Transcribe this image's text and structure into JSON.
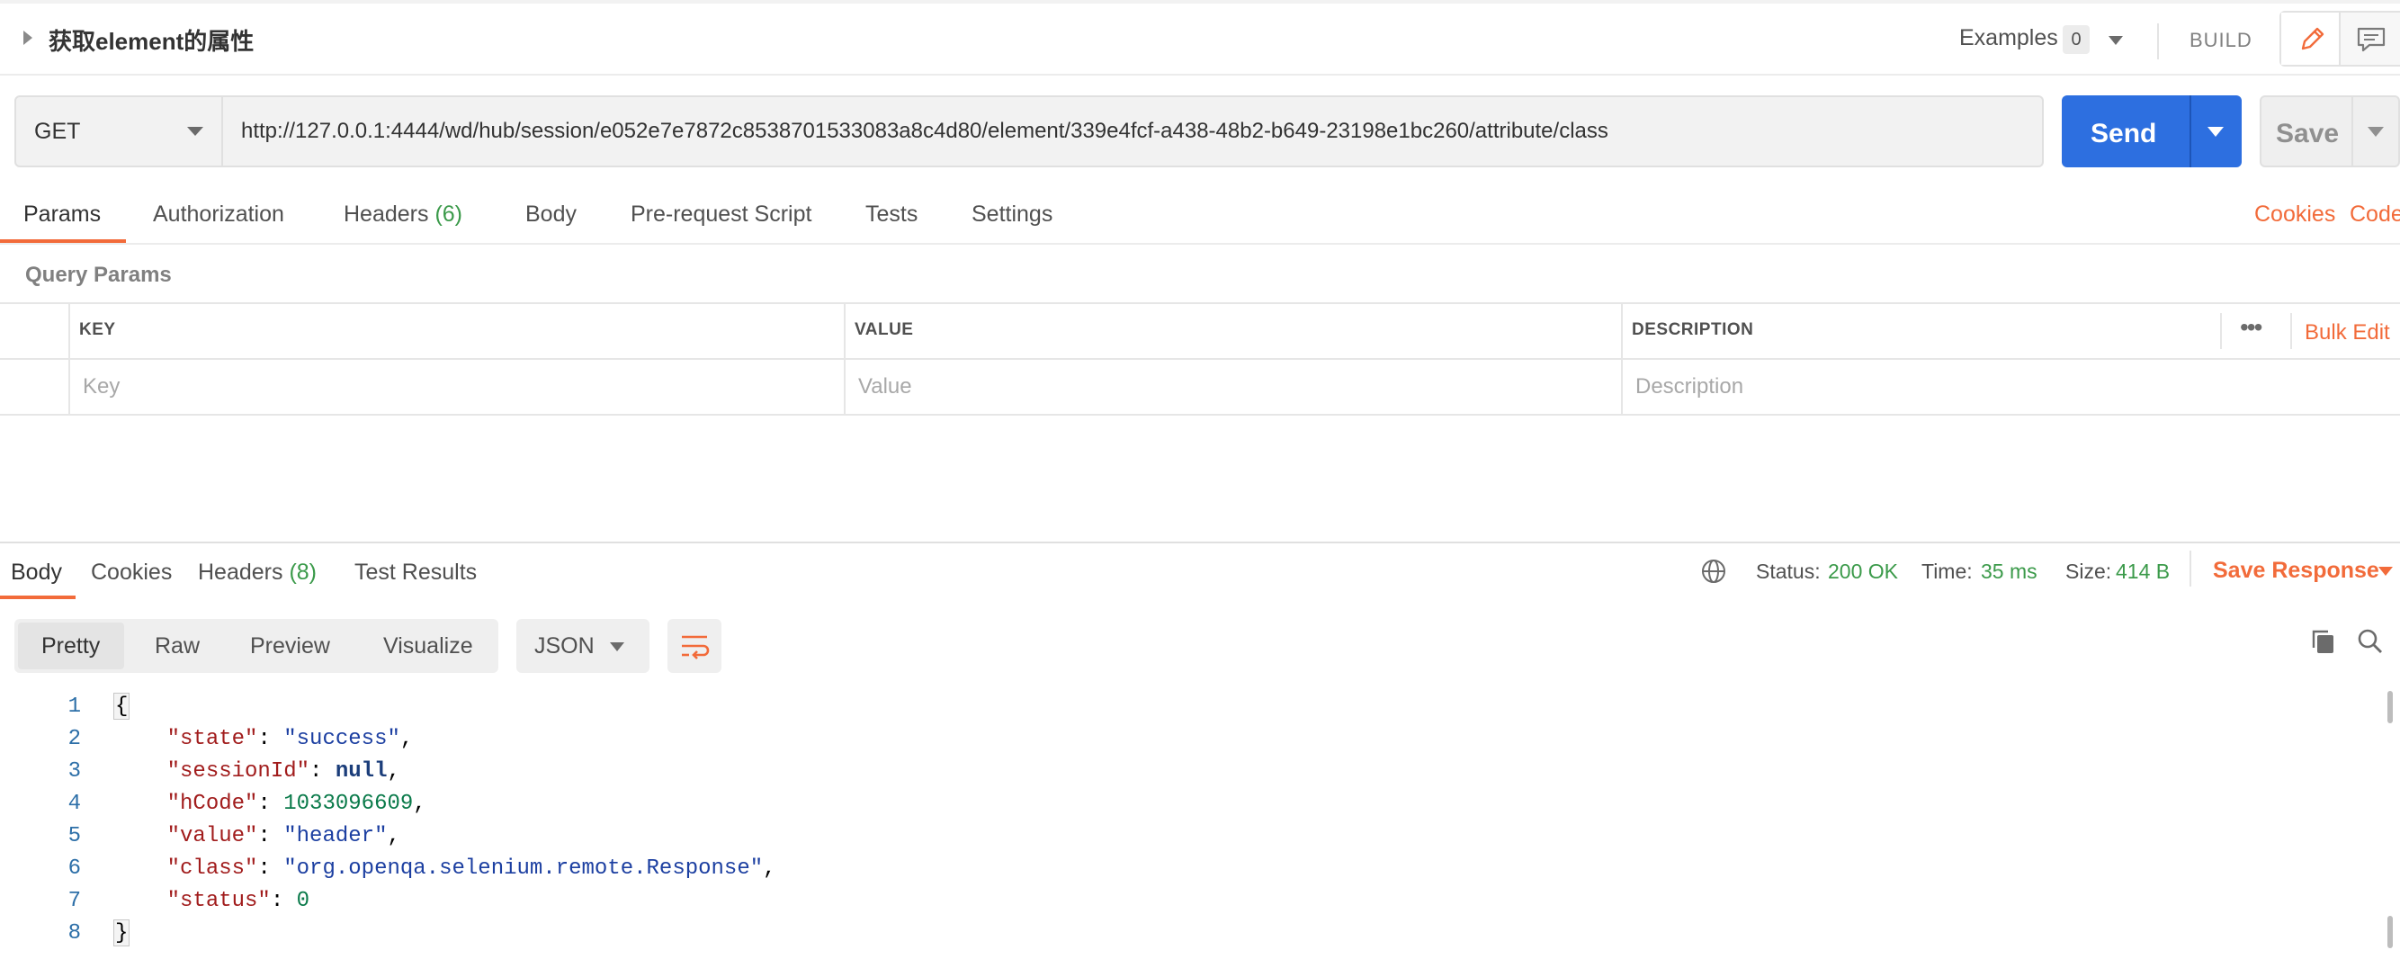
{
  "request": {
    "title": "获取element的属性",
    "examples_label": "Examples",
    "examples_count": "0",
    "build_label": "BUILD",
    "method": "GET",
    "url": "http://127.0.0.1:4444/wd/hub/session/e052e7e7872c8538701533083a8c4d80/element/339e4fcf-a438-48b2-b649-23198e1bc260/attribute/class",
    "send_label": "Send",
    "save_label": "Save"
  },
  "request_tabs": {
    "params": "Params",
    "authorization": "Authorization",
    "headers": "Headers",
    "headers_count": "(6)",
    "body": "Body",
    "prerequest": "Pre-request Script",
    "tests": "Tests",
    "settings": "Settings",
    "cookies": "Cookies",
    "code": "Code"
  },
  "query_params": {
    "label": "Query Params",
    "columns": [
      "KEY",
      "VALUE",
      "DESCRIPTION"
    ],
    "placeholders": [
      "Key",
      "Value",
      "Description"
    ],
    "more": "•••",
    "bulk_edit": "Bulk Edit"
  },
  "response_tabs": {
    "body": "Body",
    "cookies": "Cookies",
    "headers": "Headers",
    "headers_count": "(8)",
    "test_results": "Test Results"
  },
  "response_status": {
    "status_label": "Status:",
    "status_value": "200 OK",
    "time_label": "Time:",
    "time_value": "35 ms",
    "size_label": "Size:",
    "size_value": "414 B",
    "save_response": "Save Response"
  },
  "view_toolbar": {
    "modes": [
      "Pretty",
      "Raw",
      "Preview",
      "Visualize"
    ],
    "format": "JSON"
  },
  "code_lines": {
    "numbers": [
      "1",
      "2",
      "3",
      "4",
      "5",
      "6",
      "7",
      "8"
    ],
    "open_brace": "{",
    "close_brace": "}",
    "fields": [
      {
        "key": "\"state\"",
        "value": "\"success\"",
        "type": "string"
      },
      {
        "key": "\"sessionId\"",
        "value": "null",
        "type": "keyword"
      },
      {
        "key": "\"hCode\"",
        "value": "1033096609",
        "type": "number"
      },
      {
        "key": "\"value\"",
        "value": "\"header\"",
        "type": "string"
      },
      {
        "key": "\"class\"",
        "value": "\"org.openqa.selenium.remote.Response\"",
        "type": "string"
      },
      {
        "key": "\"status\"",
        "value": "0",
        "type": "number"
      }
    ]
  },
  "colors": {
    "accent_orange": "#f26b3a",
    "send_blue": "#2d6fe0",
    "status_green": "#3b9a4a",
    "json_key": "#a11c1c",
    "json_string": "#1c3fa1",
    "json_number": "#0a7a4a"
  },
  "icons": {
    "collapse": "caret-right-icon",
    "edit": "pencil-icon",
    "comment": "comment-icon",
    "globe": "globe-icon",
    "wrap": "wrap-lines-icon",
    "copy": "copy-icon",
    "search": "search-icon"
  }
}
